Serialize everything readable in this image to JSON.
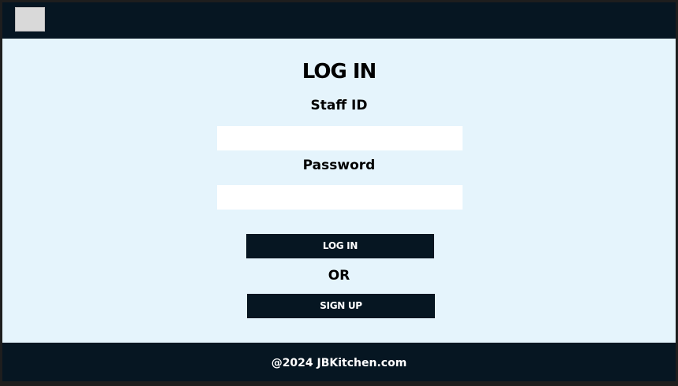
{
  "header": {
    "logo_icon": "placeholder-logo-icon"
  },
  "form": {
    "title": "LOG IN",
    "staff_id_label": "Staff ID",
    "staff_id_value": "",
    "password_label": "Password",
    "password_value": "",
    "login_button": "LOG IN",
    "or_text": "OR",
    "signup_button": "SIGN UP"
  },
  "footer": {
    "text": "@2024 JBKitchen.com"
  },
  "colors": {
    "header_bg": "#061622",
    "page_bg": "#e5f4fc",
    "button_bg": "#061622",
    "input_bg": "#ffffff"
  }
}
